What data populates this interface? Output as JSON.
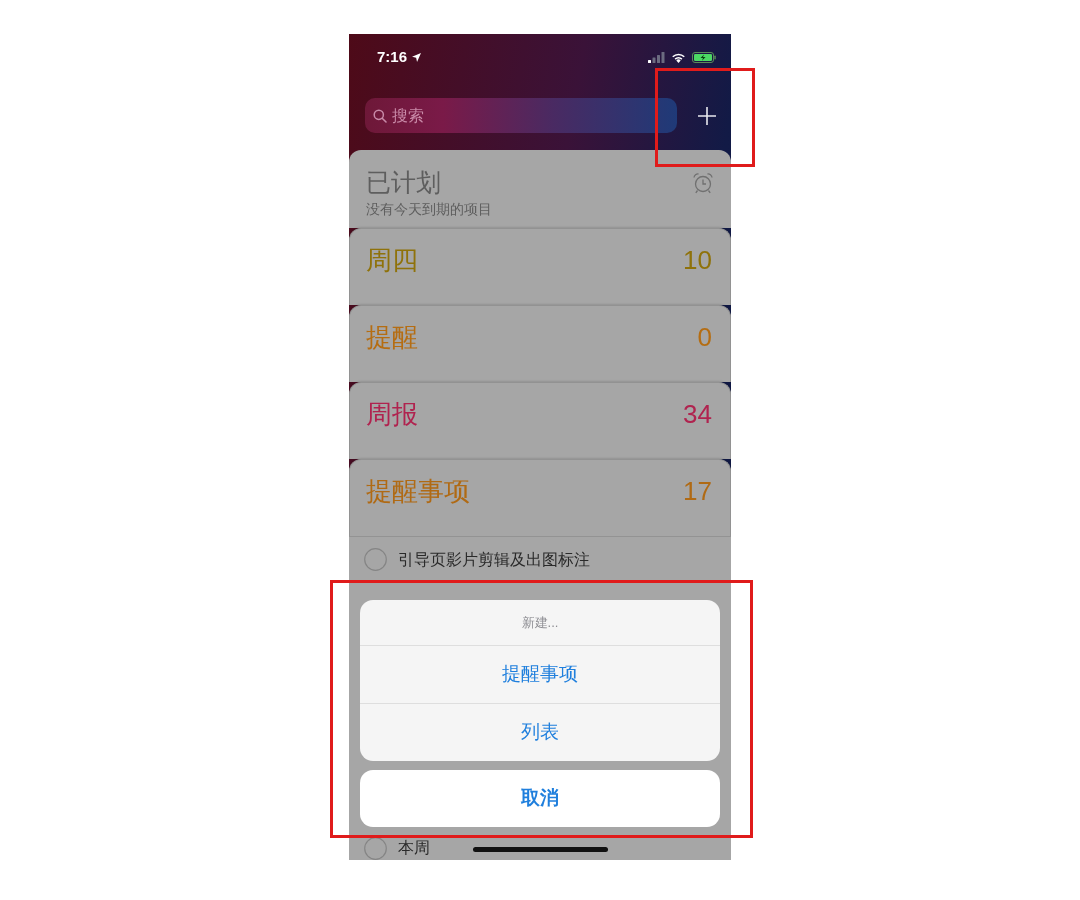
{
  "status_bar": {
    "time": "7:16"
  },
  "search": {
    "placeholder": "搜索"
  },
  "scheduled": {
    "title": "已计划",
    "subtitle": "没有今天到期的项目"
  },
  "lists": [
    {
      "name": "周四",
      "count": "10",
      "color": "#8f720a"
    },
    {
      "name": "提醒",
      "count": "0",
      "color": "#b56d12"
    },
    {
      "name": "周报",
      "count": "34",
      "color": "#b0234f"
    },
    {
      "name": "提醒事项",
      "count": "17",
      "color": "#b06a14",
      "reminders": [
        {
          "title": "引导页影片剪辑及出图标注",
          "checked": false
        },
        {
          "title": "本周",
          "checked": false
        }
      ]
    }
  ],
  "action_sheet": {
    "title": "新建...",
    "actions": [
      "提醒事项",
      "列表"
    ],
    "cancel": "取消"
  }
}
